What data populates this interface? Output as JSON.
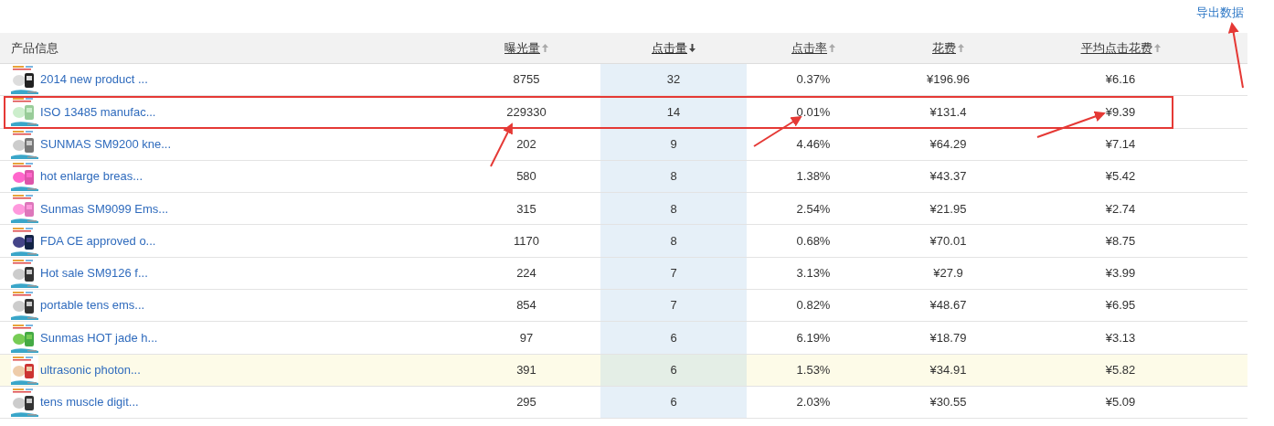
{
  "export_link": "导出数据",
  "columns": [
    {
      "label": "产品信息",
      "kind": "plain"
    },
    {
      "label": "曝光量",
      "kind": "sortable",
      "selected": false
    },
    {
      "label": "点击量",
      "kind": "sortable",
      "selected": true
    },
    {
      "label": "点击率",
      "kind": "sortable",
      "selected": false
    },
    {
      "label": "花费",
      "kind": "sortable",
      "selected": false
    },
    {
      "label": "平均点击花费",
      "kind": "sortable",
      "selected": false
    }
  ],
  "rows": [
    {
      "product": "2014 new product ...",
      "impressions": "8755",
      "clicks": "32",
      "ctr": "0.37%",
      "cost": "¥196.96",
      "avg_cpc": "¥6.16",
      "highlighted": false
    },
    {
      "product": "ISO 13485 manufac...",
      "impressions": "229330",
      "clicks": "14",
      "ctr": "0.01%",
      "cost": "¥131.4",
      "avg_cpc": "¥9.39",
      "highlighted": false
    },
    {
      "product": "SUNMAS SM9200 kne...",
      "impressions": "202",
      "clicks": "9",
      "ctr": "4.46%",
      "cost": "¥64.29",
      "avg_cpc": "¥7.14",
      "highlighted": false
    },
    {
      "product": "hot enlarge breas...",
      "impressions": "580",
      "clicks": "8",
      "ctr": "1.38%",
      "cost": "¥43.37",
      "avg_cpc": "¥5.42",
      "highlighted": false
    },
    {
      "product": "Sunmas SM9099 Ems...",
      "impressions": "315",
      "clicks": "8",
      "ctr": "2.54%",
      "cost": "¥21.95",
      "avg_cpc": "¥2.74",
      "highlighted": false
    },
    {
      "product": "FDA CE approved o...",
      "impressions": "1170",
      "clicks": "8",
      "ctr": "0.68%",
      "cost": "¥70.01",
      "avg_cpc": "¥8.75",
      "highlighted": false
    },
    {
      "product": "Hot sale SM9126 f...",
      "impressions": "224",
      "clicks": "7",
      "ctr": "3.13%",
      "cost": "¥27.9",
      "avg_cpc": "¥3.99",
      "highlighted": false
    },
    {
      "product": "portable tens ems...",
      "impressions": "854",
      "clicks": "7",
      "ctr": "0.82%",
      "cost": "¥48.67",
      "avg_cpc": "¥6.95",
      "highlighted": false
    },
    {
      "product": "Sunmas HOT jade h...",
      "impressions": "97",
      "clicks": "6",
      "ctr": "6.19%",
      "cost": "¥18.79",
      "avg_cpc": "¥3.13",
      "highlighted": false
    },
    {
      "product": "ultrasonic photon...",
      "impressions": "391",
      "clicks": "6",
      "ctr": "1.53%",
      "cost": "¥34.91",
      "avg_cpc": "¥5.82",
      "highlighted": true
    },
    {
      "product": "tens muscle digit...",
      "impressions": "295",
      "clicks": "6",
      "ctr": "2.03%",
      "cost": "¥30.55",
      "avg_cpc": "¥5.09",
      "highlighted": false
    }
  ]
}
